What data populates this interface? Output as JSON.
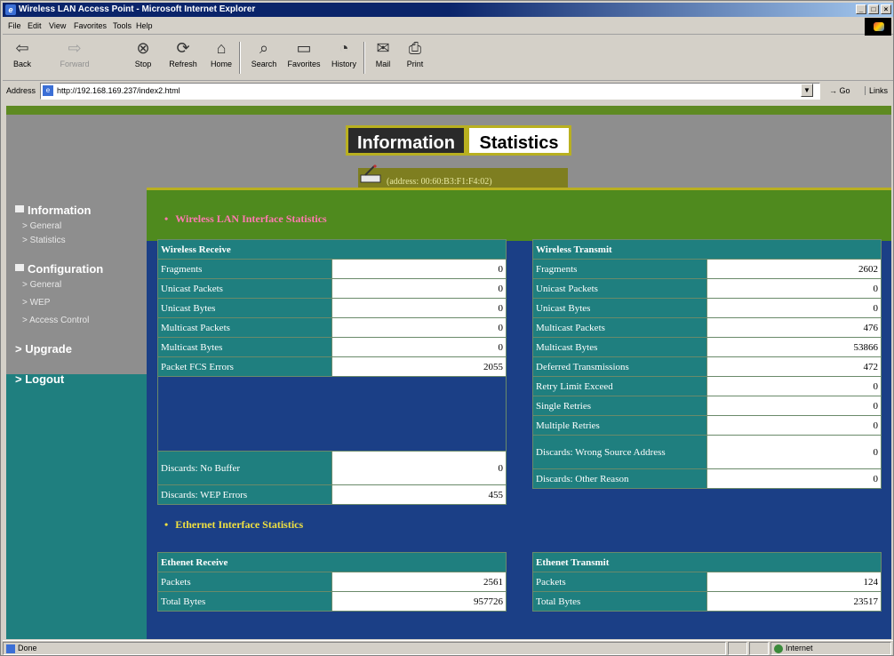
{
  "window": {
    "title": "Wireless LAN Access Point - Microsoft Internet Explorer",
    "controls": [
      "minimize",
      "maximize",
      "close"
    ]
  },
  "menu": [
    "File",
    "Edit",
    "View",
    "Favorites",
    "Tools",
    "Help"
  ],
  "toolbar": {
    "back": "Back",
    "forward": "Forward",
    "stop": "Stop",
    "refresh": "Refresh",
    "home": "Home",
    "search": "Search",
    "favorites": "Favorites",
    "history": "History",
    "mail": "Mail",
    "print": "Print"
  },
  "address": {
    "label": "Address",
    "url": "http://192.168.169.237/index2.html",
    "go": "Go",
    "links": "Links"
  },
  "header": {
    "tab_information": "Information",
    "tab_statistics": "Statistics",
    "mac_address": "(address: 00:60:B3:F1:F4:02)"
  },
  "nav": {
    "information": "Information",
    "info_general": "> General",
    "info_statistics": "> Statistics",
    "configuration": "Configuration",
    "config_general": "> General",
    "config_wep": "> WEP",
    "config_access": "> Access Control",
    "upgrade": "> Upgrade",
    "logout": "> Logout"
  },
  "wireless": {
    "title": "Wireless LAN Interface Statistics",
    "receive_header": "Wireless Receive",
    "transmit_header": "Wireless Transmit",
    "receive": [
      {
        "label": "Fragments",
        "value": "0"
      },
      {
        "label": "Unicast Packets",
        "value": "0"
      },
      {
        "label": "Unicast Bytes",
        "value": "0"
      },
      {
        "label": "Multicast Packets",
        "value": "0"
      },
      {
        "label": "Multicast Bytes",
        "value": "0"
      },
      {
        "label": "Packet FCS Errors",
        "value": "2055"
      }
    ],
    "receive_bottom": [
      {
        "label": "Discards: No Buffer",
        "value": "0"
      },
      {
        "label": "Discards: WEP Errors",
        "value": "455"
      }
    ],
    "transmit": [
      {
        "label": "Fragments",
        "value": "2602"
      },
      {
        "label": "Unicast Packets",
        "value": "0"
      },
      {
        "label": "Unicast Bytes",
        "value": "0"
      },
      {
        "label": "Multicast Packets",
        "value": "476"
      },
      {
        "label": "Multicast Bytes",
        "value": "53866"
      },
      {
        "label": "Deferred Transmissions",
        "value": "472"
      },
      {
        "label": "Retry Limit Exceed",
        "value": "0"
      },
      {
        "label": "Single Retries",
        "value": "0"
      },
      {
        "label": "Multiple Retries",
        "value": "0"
      },
      {
        "label": "Discards: Wrong Source Address",
        "value": "0"
      },
      {
        "label": "Discards: Other Reason",
        "value": "0"
      }
    ]
  },
  "ethernet": {
    "title": "Ethernet Interface Statistics",
    "receive_header": "Ethenet Receive",
    "transmit_header": "Ethenet Transmit",
    "receive": [
      {
        "label": "Packets",
        "value": "2561"
      },
      {
        "label": "Total Bytes",
        "value": "957726"
      }
    ],
    "transmit": [
      {
        "label": "Packets",
        "value": "124"
      },
      {
        "label": "Total Bytes",
        "value": "23517"
      }
    ]
  },
  "status": {
    "text": "Done",
    "zone": "Internet"
  },
  "colors": {
    "title_bar": "#0a246a",
    "header_gray": "#8e8e8e",
    "page_blue": "#1b3f86",
    "teal": "#1f7f7f",
    "green": "#4f8a1e",
    "yellow": "#b9b020"
  }
}
